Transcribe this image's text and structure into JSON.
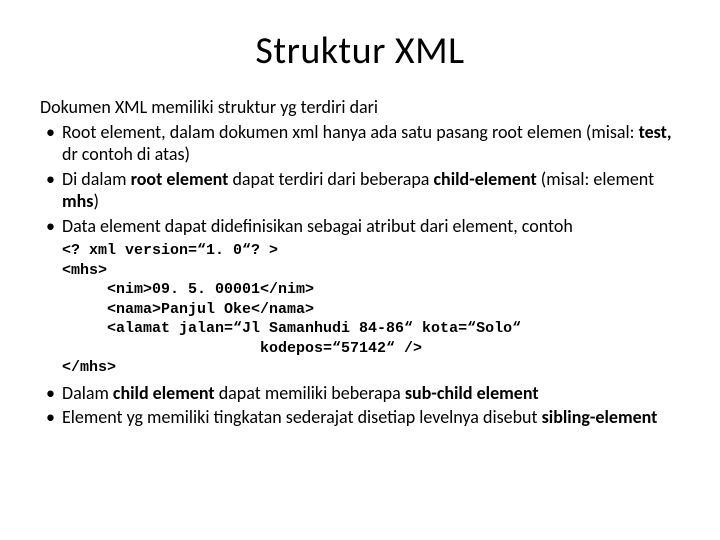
{
  "title": "Struktur XML",
  "intro": "Dokumen XML memiliki struktur yg terdiri dari",
  "bullets_top": [
    {
      "html": "Root element, dalam dokumen xml hanya ada satu pasang root elemen (misal: <b>test,</b> dr contoh di atas)"
    },
    {
      "html": "Di dalam <b>root element</b> dapat terdiri dari beberapa <b>child-element</b> (misal: element <b>mhs</b>)"
    },
    {
      "html": "Data element dapat didefinisikan sebagai atribut dari element, contoh"
    }
  ],
  "code": "<? xml version=\"1. 0\"? >\n<mhs>\n     <nim>09. 5. 00001</nim>\n     <nama>Panjul Oke</nama>\n     <alamat jalan=\"Jl Samanhudi 84-86\" kota=\"Solo\"\n                      kodepos=\"57142\" />\n</mhs>",
  "bullets_bottom": [
    {
      "html": "Dalam <b>child element</b> dapat memiliki beberapa <b>sub-child element</b>"
    },
    {
      "html": "Element yg memiliki tingkatan sederajat disetiap levelnya disebut <b>sibling-element</b>"
    }
  ]
}
